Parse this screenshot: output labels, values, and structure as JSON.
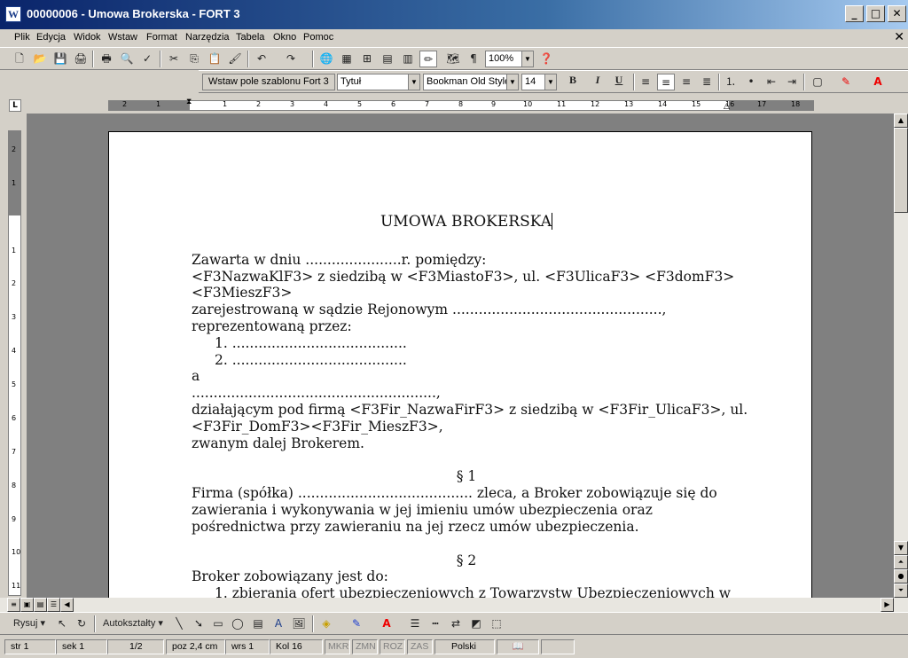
{
  "window": {
    "title": "00000006 - Umowa Brokerska - FORT 3",
    "icon_name": "word-document-icon",
    "controls": {
      "minimize": "_",
      "maximize": "□",
      "close": "✕"
    }
  },
  "menu": [
    "Plik",
    "Edycja",
    "Widok",
    "Wstaw",
    "Format",
    "Narzędzia",
    "Tabela",
    "Okno",
    "Pomoc"
  ],
  "menu_close": "✕",
  "standard_toolbar": {
    "zoom": "100%",
    "buttons": [
      "new-icon",
      "open-icon",
      "save-icon",
      "permission-icon",
      "print-icon",
      "print-preview-icon",
      "spelling-icon",
      "cut-icon",
      "copy-icon",
      "paste-icon",
      "format-painter-icon",
      "undo-icon",
      "redo-icon",
      "hyperlink-icon",
      "tables-borders-icon",
      "insert-table-icon",
      "insert-excel-icon",
      "columns-icon",
      "drawing-icon",
      "document-map-icon",
      "show-formatting-icon",
      "help-icon"
    ]
  },
  "formatting_toolbar": {
    "fort_button": "Wstaw pole szablonu Fort 3",
    "style": "Tytuł",
    "font": "Bookman Old Style",
    "size": "14",
    "bold": "B",
    "italic": "I",
    "underline": "U",
    "paragraph_mark": "¶"
  },
  "ruler": {
    "numbers": [
      "2",
      "1",
      "1",
      "2",
      "3",
      "4",
      "5",
      "6",
      "7",
      "8",
      "9",
      "10",
      "11",
      "12",
      "13",
      "14",
      "15",
      "16",
      "17",
      "18"
    ]
  },
  "vruler": {
    "numbers": [
      "2",
      "1",
      "1",
      "2",
      "3",
      "4",
      "5",
      "6",
      "7",
      "8",
      "9",
      "10",
      "11"
    ]
  },
  "document": {
    "title": "UMOWA BROKERSKA",
    "lines": [
      "Zawarta w dniu ......................r. pomiędzy:",
      "<F3NazwaKlF3> z siedzibą w <F3MiastoF3>, ul. <F3UlicaF3> <F3domF3>",
      "<F3MieszF3>",
      "zarejestrowaną w sądzie Rejonowym ................................................,",
      "reprezentowaną przez:"
    ],
    "list1": [
      "1.  ........................................",
      "2.  ........................................"
    ],
    "lines2": [
      "a",
      "........................................................,",
      "działającym pod firmą <F3Fir_NazwaFirF3> z siedzibą w <F3Fir_UlicaF3>, ul.",
      "<F3Fir_DomF3><F3Fir_MieszF3>,",
      "zwanym dalej Brokerem."
    ],
    "section1": "§ 1",
    "section1_text": [
      "Firma (spółka) ........................................ zleca, a Broker zobowiązuje się do",
      "zawierania i wykonywania w jej imieniu umów ubezpieczenia oraz",
      "pośrednictwa przy zawieraniu na jej rzecz umów ubezpieczenia."
    ],
    "section2": "§ 2",
    "section2_text": "Broker zobowiązany jest do:",
    "section2_item": "1.  zbierania ofert ubezpieczeniowych z Towarzystw Ubezpieczeniowych w"
  },
  "drawing_toolbar": {
    "draw": "Rysuj",
    "autoshapes": "Autokształty"
  },
  "statusbar": {
    "page": "str 1",
    "section": "sek 1",
    "pages": "1/2",
    "position": "poz 2,4 cm",
    "line": "wrs 1",
    "column": "Kol 16",
    "rec": "MKR",
    "trk": "ZMN",
    "ext": "ROZ",
    "ovr": "ZAS",
    "language": "Polski"
  }
}
